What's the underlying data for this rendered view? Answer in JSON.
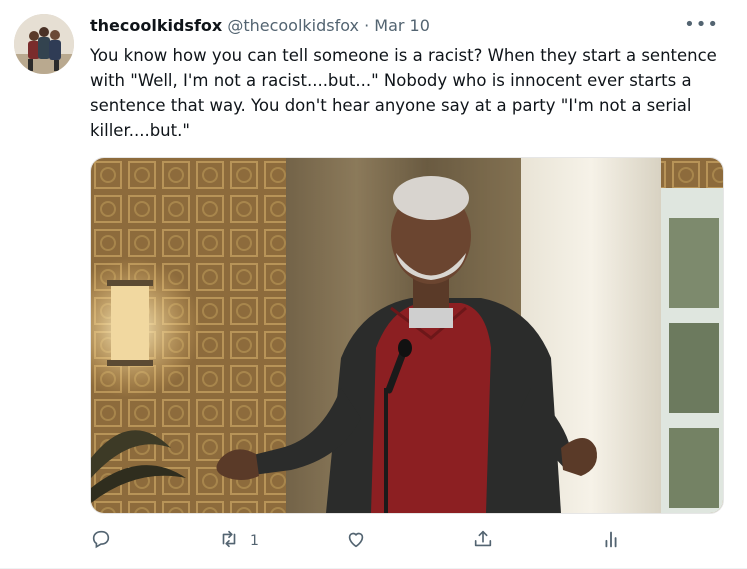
{
  "tweet": {
    "display_name": "thecoolkidsfox",
    "handle": "@thecoolkidsfox",
    "separator": "·",
    "date": "Mar 10",
    "more": "•••",
    "text": "You know how you can tell someone is a racist? When they start a sentence with \"Well, I'm not a racist....but...\" Nobody who is innocent ever starts a sentence that way. You don't hear anyone say at a party \"I'm not a serial killer....but.\"",
    "actions": {
      "reply_icon": "reply-icon",
      "retweet_icon": "retweet-icon",
      "retweet_count": "1",
      "like_icon": "heart-icon",
      "share_icon": "share-icon",
      "analytics_icon": "analytics-icon"
    }
  },
  "colors": {
    "text_primary": "#0f1419",
    "text_secondary": "#536471",
    "wallpaper": "#8a6a3a",
    "shirt": "#8c1f22",
    "cardigan": "#2b2c2b"
  }
}
